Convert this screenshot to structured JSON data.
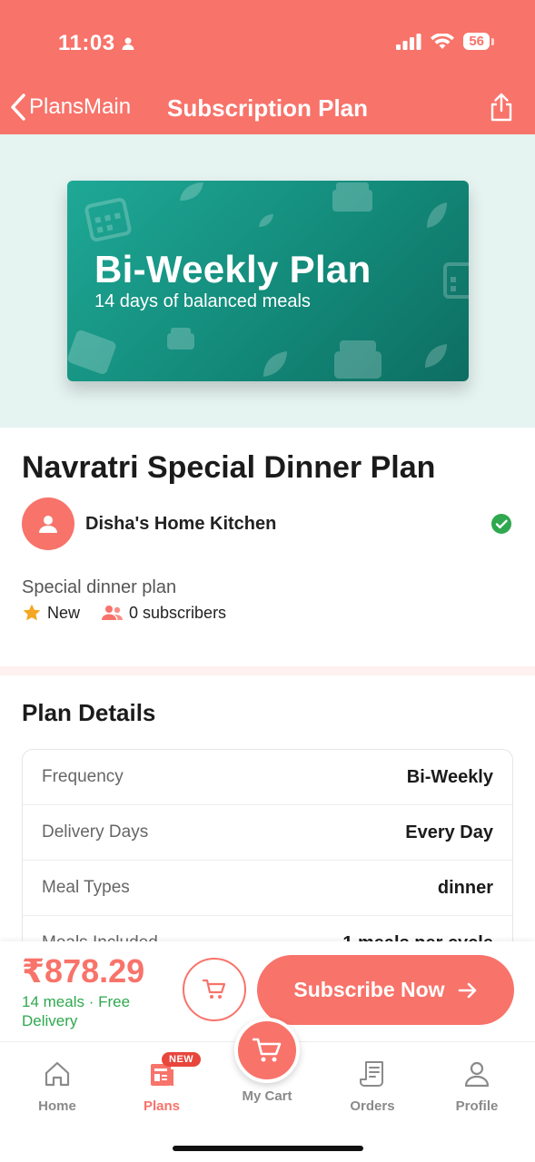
{
  "status_bar": {
    "time": "11:03",
    "battery": "56"
  },
  "nav": {
    "back_label": "PlansMain",
    "title": "Subscription Plan"
  },
  "banner": {
    "title": "Bi-Weekly Plan",
    "subtitle": "14 days of balanced meals"
  },
  "plan": {
    "title": "Navratri Special Dinner Plan",
    "kitchen": "Disha's Home Kitchen",
    "description": "Special dinner plan",
    "rating_label": "New",
    "subscribers": "0 subscribers"
  },
  "details": {
    "heading": "Plan Details",
    "rows": [
      {
        "label": "Frequency",
        "value": "Bi-Weekly"
      },
      {
        "label": "Delivery Days",
        "value": "Every Day"
      },
      {
        "label": "Meal Types",
        "value": "dinner"
      },
      {
        "label": "Meals Included",
        "value": "1 meals per cycle"
      }
    ]
  },
  "footer": {
    "price": "₹878.29",
    "price_sub": "14 meals · Free Delivery",
    "subscribe_label": "Subscribe Now"
  },
  "tabs": {
    "home": "Home",
    "plans": "Plans",
    "plans_badge": "NEW",
    "cart": "My Cart",
    "orders": "Orders",
    "profile": "Profile"
  },
  "colors": {
    "accent": "#F8736A",
    "banner": "#138A7A",
    "success": "#2FA84F"
  }
}
